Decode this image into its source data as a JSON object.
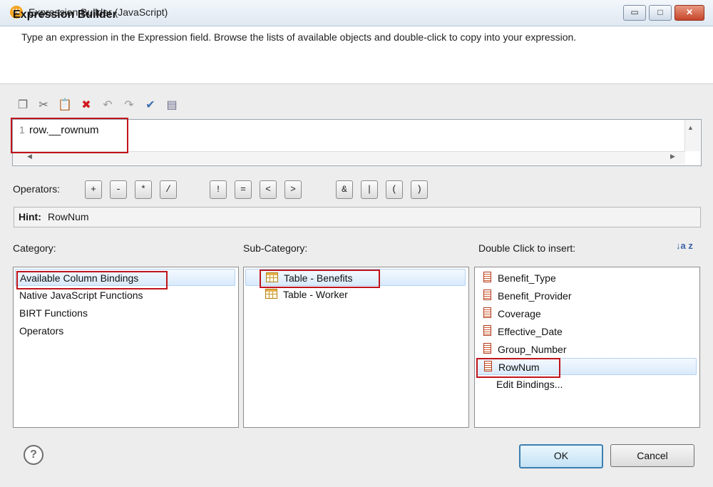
{
  "window": {
    "title": "Expression Builder (JavaScript)",
    "app_icon": "W",
    "minimize_glyph": "▭",
    "maximize_glyph": "□",
    "close_glyph": "✕"
  },
  "header": {
    "title": "Expression Builder",
    "description": "Type an expression in the Expression field. Browse the lists of available objects and double-click to copy into your expression."
  },
  "toolbar": {
    "icons": [
      "copy-icon",
      "cut-icon",
      "paste-icon",
      "delete-icon",
      "undo-icon",
      "redo-icon",
      "validate-icon",
      "preview-icon"
    ],
    "glyphs": {
      "copy": "❐",
      "cut": "✂",
      "paste": "📋",
      "delete": "✖",
      "undo": "↶",
      "redo": "↷",
      "validate": "✔",
      "preview": "▤"
    }
  },
  "editor": {
    "line_number": "1",
    "expression": "row.__rownum",
    "scroll_up": "▲",
    "scroll_left": "◀",
    "scroll_right": "▶"
  },
  "operators": {
    "label": "Operators:",
    "buttons": [
      "+",
      "-",
      "*",
      "/",
      "!",
      "=",
      "<",
      ">",
      "&",
      "|",
      "(",
      ")"
    ]
  },
  "hint": {
    "label": "Hint:",
    "value": "RowNum"
  },
  "category": {
    "label": "Category:",
    "items": [
      "Available Column Bindings",
      "Native JavaScript Functions",
      "BIRT Functions",
      "Operators"
    ]
  },
  "subcategory": {
    "label": "Sub-Category:",
    "items": [
      "Table - Benefits",
      "Table - Worker"
    ]
  },
  "insert": {
    "label": "Double Click to insert:",
    "sort_glyph": "↓a z",
    "items": [
      "Benefit_Type",
      "Benefit_Provider",
      "Coverage",
      "Effective_Date",
      "Group_Number",
      "RowNum"
    ],
    "edit_bindings": "Edit Bindings..."
  },
  "footer": {
    "help_glyph": "?",
    "ok_label": "OK",
    "cancel_label": "Cancel"
  },
  "colors": {
    "highlight_border": "#c0141c",
    "selection_fill": "#d9eafb",
    "title_bar": "#dfe8f2",
    "close_button": "#c6452b",
    "dialog_body": "#ededed"
  }
}
